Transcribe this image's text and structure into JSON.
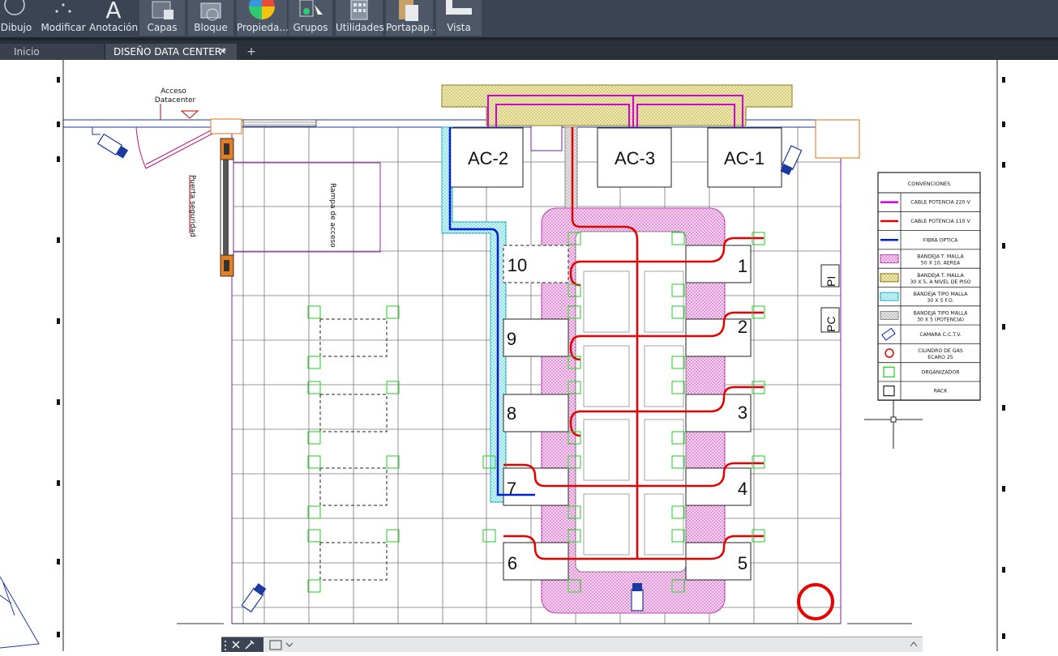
{
  "ribbon": {
    "panels": [
      {
        "label": "Dibujo"
      },
      {
        "label": "Modificar"
      },
      {
        "label": "Anotación"
      },
      {
        "label": "Capas"
      },
      {
        "label": "Bloque"
      },
      {
        "label": "Propieda..."
      },
      {
        "label": "Grupos"
      },
      {
        "label": "Utilidades"
      },
      {
        "label": "Portapap..."
      },
      {
        "label": "Vista"
      }
    ]
  },
  "tabs": {
    "home": "Inicio",
    "document": "DISEÑO DATA CENTER*",
    "close": "✕",
    "add": "+"
  },
  "drawing": {
    "access_label_1": "Acceso",
    "access_label_2": "Datacenter",
    "security_door": "Puerta seguridad",
    "ramp": "Rampa de acceso",
    "ac": [
      "AC-2",
      "AC-3",
      "AC-1"
    ],
    "racks_right": [
      "1",
      "2",
      "3",
      "4",
      "5"
    ],
    "racks_left": [
      "10",
      "9",
      "8",
      "7",
      "6"
    ],
    "side_labels": [
      "PI",
      "PC"
    ]
  },
  "legend": {
    "title": "CONVENCIONES",
    "items": [
      {
        "symbol": "line-magenta",
        "text1": "CABLE POTENCIA 220 V",
        "text2": ""
      },
      {
        "symbol": "line-red",
        "text1": "CABLE POTENCIA 110 V",
        "text2": ""
      },
      {
        "symbol": "line-blue",
        "text1": "FIBRA OPTICA",
        "text2": ""
      },
      {
        "symbol": "hatch-pink",
        "text1": "BANDEJA T. MALLA",
        "text2": "50 X 10, AEREA"
      },
      {
        "symbol": "hatch-yellow",
        "text1": "BANDEJA T. MALLA",
        "text2": "30 X 5, A NIVEL DE PISO"
      },
      {
        "symbol": "hatch-cyan",
        "text1": "BANDEJA TIPO MALLA",
        "text2": "30 X 5 F.O."
      },
      {
        "symbol": "hatch-gray",
        "text1": "BANDEJA TIPO MALLA",
        "text2": "30 X 5 (POTENCIA)"
      },
      {
        "symbol": "camera",
        "text1": "CAMARA C.C.T.V.",
        "text2": ""
      },
      {
        "symbol": "gas",
        "text1": "CILINDRO DE GAS",
        "text2": "ECARO 25"
      },
      {
        "symbol": "organizer",
        "text1": "ORGANIZADOR",
        "text2": ""
      },
      {
        "symbol": "rack",
        "text1": "RACK",
        "text2": ""
      }
    ]
  },
  "colors": {
    "ribbon_bg": "#3b4453",
    "power220": "#d400d4",
    "power110": "#e60000",
    "fiber": "#0020d0",
    "grid": "#5a5a5a",
    "wall": "#7020a0",
    "organizer": "#22cc22"
  }
}
